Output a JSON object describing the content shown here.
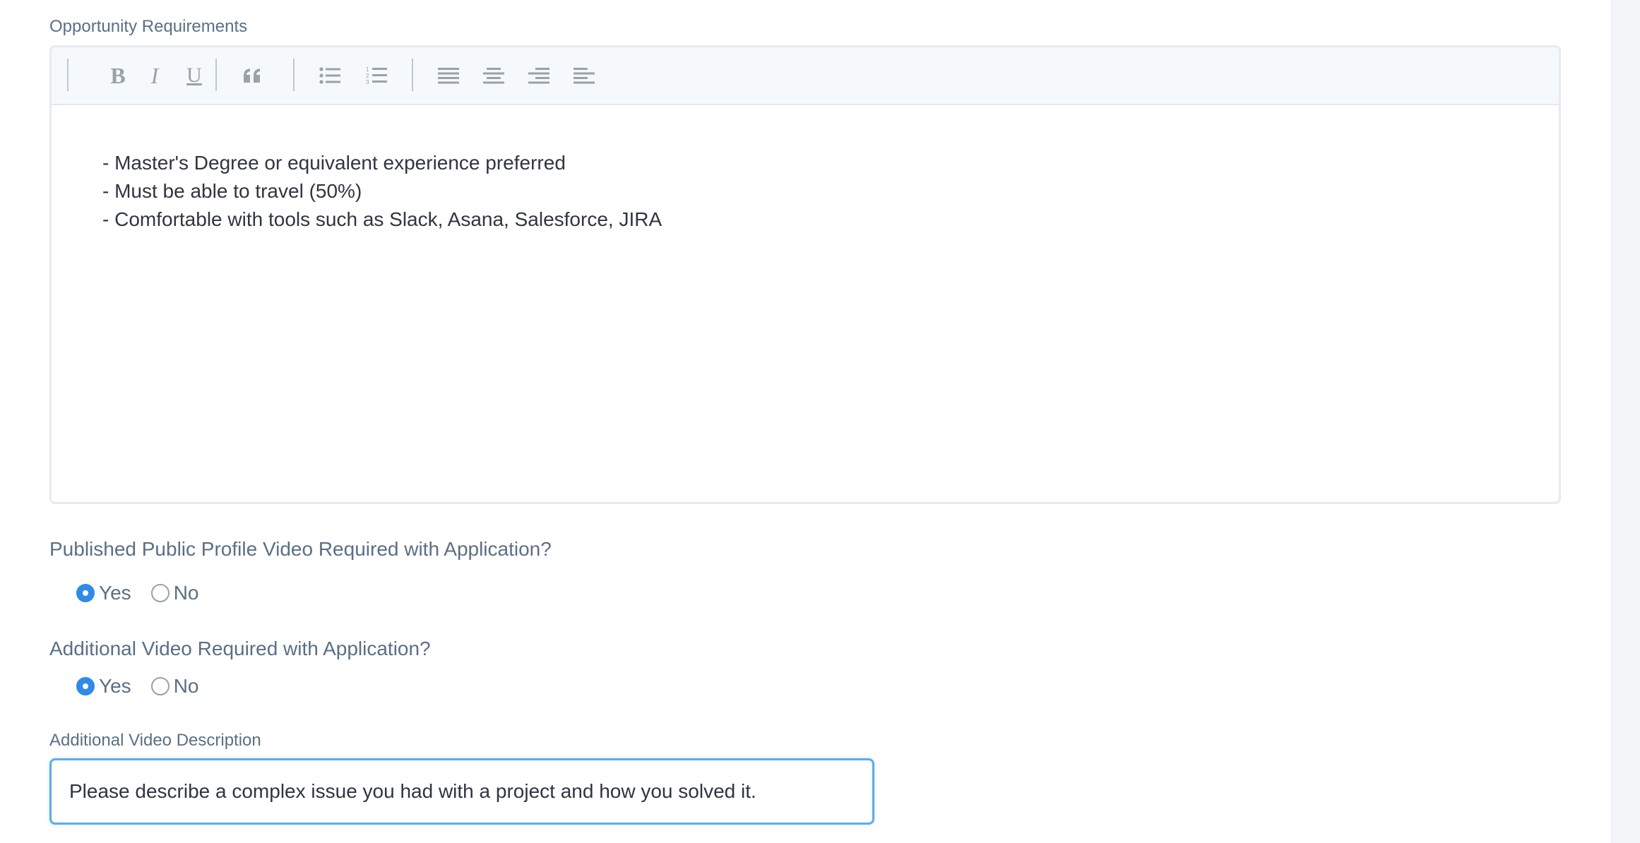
{
  "requirements": {
    "label": "Opportunity Requirements",
    "lines": [
      "- Master's Degree or equivalent experience preferred",
      "- Must be able to travel (50%)",
      "- Comfortable with tools such as Slack, Asana, Salesforce, JIRA"
    ],
    "toolbar": {
      "bold": "B",
      "italic": "I",
      "underline": "U"
    }
  },
  "profile_video": {
    "question": "Published Public Profile Video Required with Application?",
    "options": [
      "Yes",
      "No"
    ],
    "selected": "Yes"
  },
  "additional_video": {
    "question": "Additional Video Required with Application?",
    "options": [
      "Yes",
      "No"
    ],
    "selected": "Yes"
  },
  "description": {
    "label": "Additional Video Description",
    "value": "Please describe a complex issue you had with a project and how you solved it."
  },
  "colors": {
    "accent": "#2f8be6",
    "label": "#5a6f86",
    "focus_border": "#5dade8"
  }
}
